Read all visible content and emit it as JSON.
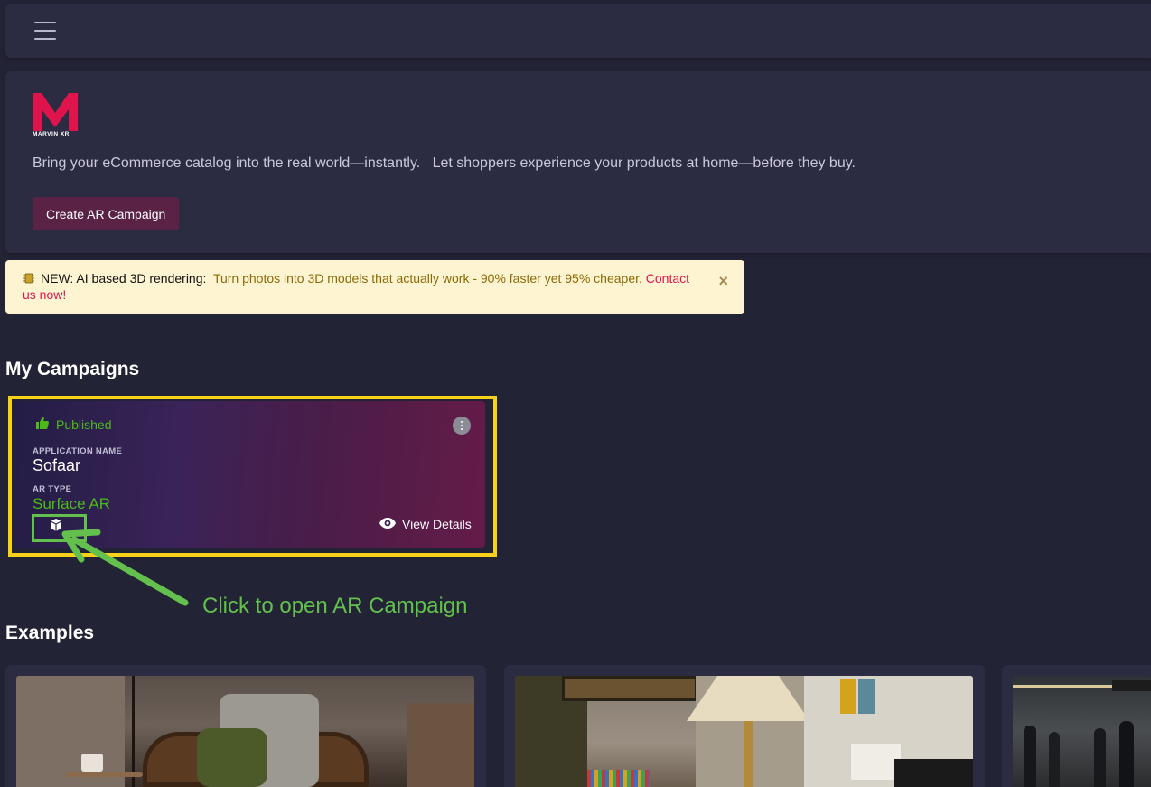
{
  "topbar": {
    "menu_icon": "hamburger-menu-icon"
  },
  "hero": {
    "logo_text": "MARVIN XR",
    "logo_letter": "M",
    "tagline": "Bring your eCommerce catalog into the real world—instantly.   Let shoppers experience your products at home—before they buy.",
    "create_button": "Create AR Campaign"
  },
  "alert": {
    "icon": "chip-icon",
    "prefix": "NEW: AI based 3D rendering:",
    "highlight": "Turn photos into 3D models that actually work - 90% faster yet 95% cheaper.",
    "link": "Contact us now!",
    "close": "×"
  },
  "campaigns": {
    "title": "My Campaigns",
    "items": [
      {
        "status": "Published",
        "app_name_label": "APPLICATION NAME",
        "app_name": "Sofaar",
        "ar_type_label": "AR TYPE",
        "ar_type": "Surface AR",
        "view_details": "View Details"
      }
    ]
  },
  "annotation": {
    "text": "Click to open AR Campaign"
  },
  "examples": {
    "title": "Examples"
  },
  "colors": {
    "accent_green": "#4cbb17",
    "brand_pink": "#e0144c",
    "highlight_yellow": "#f7d11a",
    "annotation_green": "#63c04d",
    "button_bg": "#5a2345"
  }
}
